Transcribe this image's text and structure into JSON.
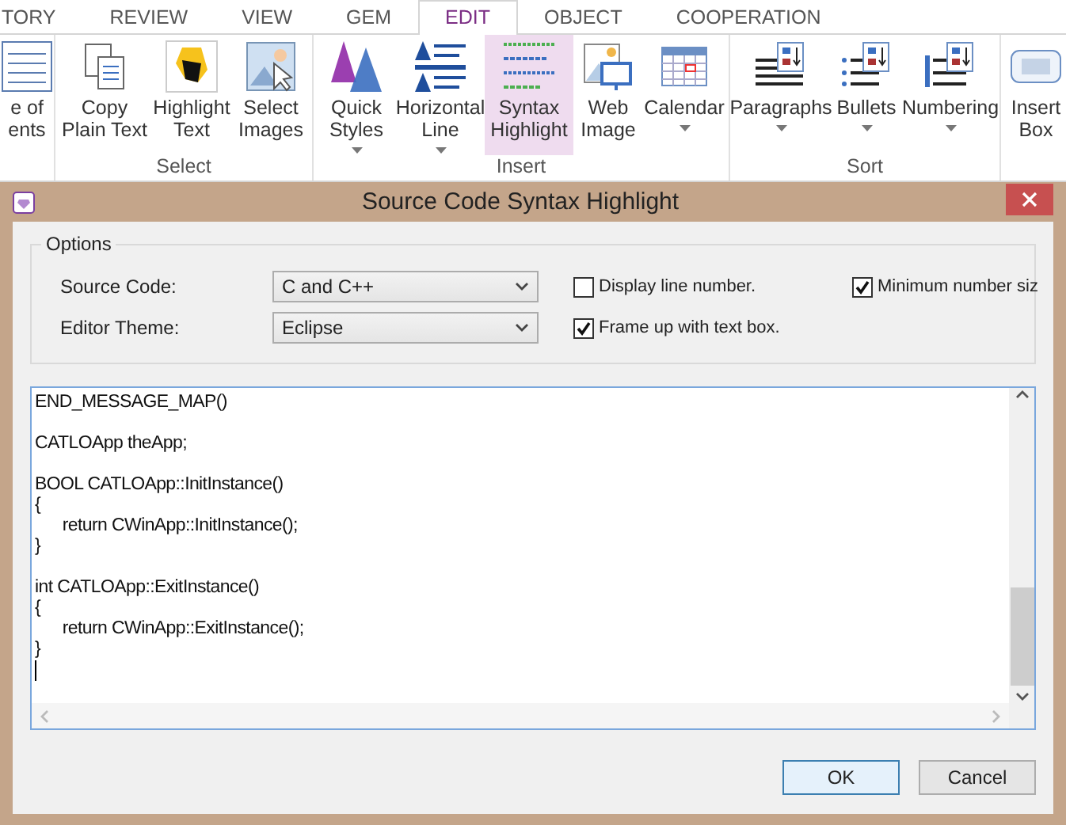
{
  "ribbon": {
    "tabs": [
      {
        "label": "TORY",
        "selected": false
      },
      {
        "label": "REVIEW",
        "selected": false
      },
      {
        "label": "VIEW",
        "selected": false
      },
      {
        "label": "GEM",
        "selected": false
      },
      {
        "label": "EDIT",
        "selected": true
      },
      {
        "label": "OBJECT",
        "selected": false
      },
      {
        "label": "COOPERATION",
        "selected": false
      }
    ],
    "groups": [
      {
        "items": [
          {
            "lines": [
              "e of",
              "ents"
            ],
            "caret": false,
            "selected": false
          }
        ]
      },
      {
        "label": "Select",
        "items": [
          {
            "lines": [
              "Copy",
              "Plain Text"
            ],
            "caret": false,
            "selected": false
          },
          {
            "lines": [
              "Highlight",
              "Text"
            ],
            "caret": false,
            "selected": false
          },
          {
            "lines": [
              "Select",
              "Images"
            ],
            "caret": false,
            "selected": false
          }
        ]
      },
      {
        "label": "Insert",
        "items": [
          {
            "lines": [
              "Quick",
              "Styles"
            ],
            "caret": true,
            "selected": false
          },
          {
            "lines": [
              "Horizontal",
              "Line"
            ],
            "caret": true,
            "selected": false
          },
          {
            "lines": [
              "Syntax",
              "Highlight"
            ],
            "caret": false,
            "selected": true
          },
          {
            "lines": [
              "Web",
              "Image"
            ],
            "caret": false,
            "selected": false
          },
          {
            "lines": [
              "Calendar"
            ],
            "caret": true,
            "selected": false
          }
        ]
      },
      {
        "label": "Sort",
        "items": [
          {
            "lines": [
              "Paragraphs"
            ],
            "caret": true,
            "selected": false
          },
          {
            "lines": [
              "Bullets"
            ],
            "caret": true,
            "selected": false
          },
          {
            "lines": [
              "Numbering"
            ],
            "caret": true,
            "selected": false
          }
        ]
      },
      {
        "items": [
          {
            "lines": [
              "Insert",
              "Box"
            ],
            "caret": false,
            "selected": false
          }
        ]
      }
    ]
  },
  "dialog": {
    "title": "Source Code Syntax Highlight",
    "options": {
      "title": "Options",
      "fields": [
        {
          "label": "Source Code:",
          "value": "C and C++"
        },
        {
          "label": "Editor Theme:",
          "value": "Eclipse"
        }
      ],
      "checkboxes": [
        {
          "label": "Display line number.",
          "checked": false
        },
        {
          "label": "Frame up with text box.",
          "checked": true
        },
        {
          "label": "Minimum number siz",
          "checked": true
        }
      ]
    },
    "code": "END_MESSAGE_MAP()\n\nCATLOApp theApp;\n\nBOOL CATLOApp::InitInstance()\n{\n\treturn CWinApp::InitInstance();\n}\n\nint CATLOApp::ExitInstance()\n{\n\treturn CWinApp::ExitInstance();\n}",
    "buttons": [
      {
        "label": "OK",
        "selected": true
      },
      {
        "label": "Cancel",
        "selected": false
      }
    ]
  }
}
